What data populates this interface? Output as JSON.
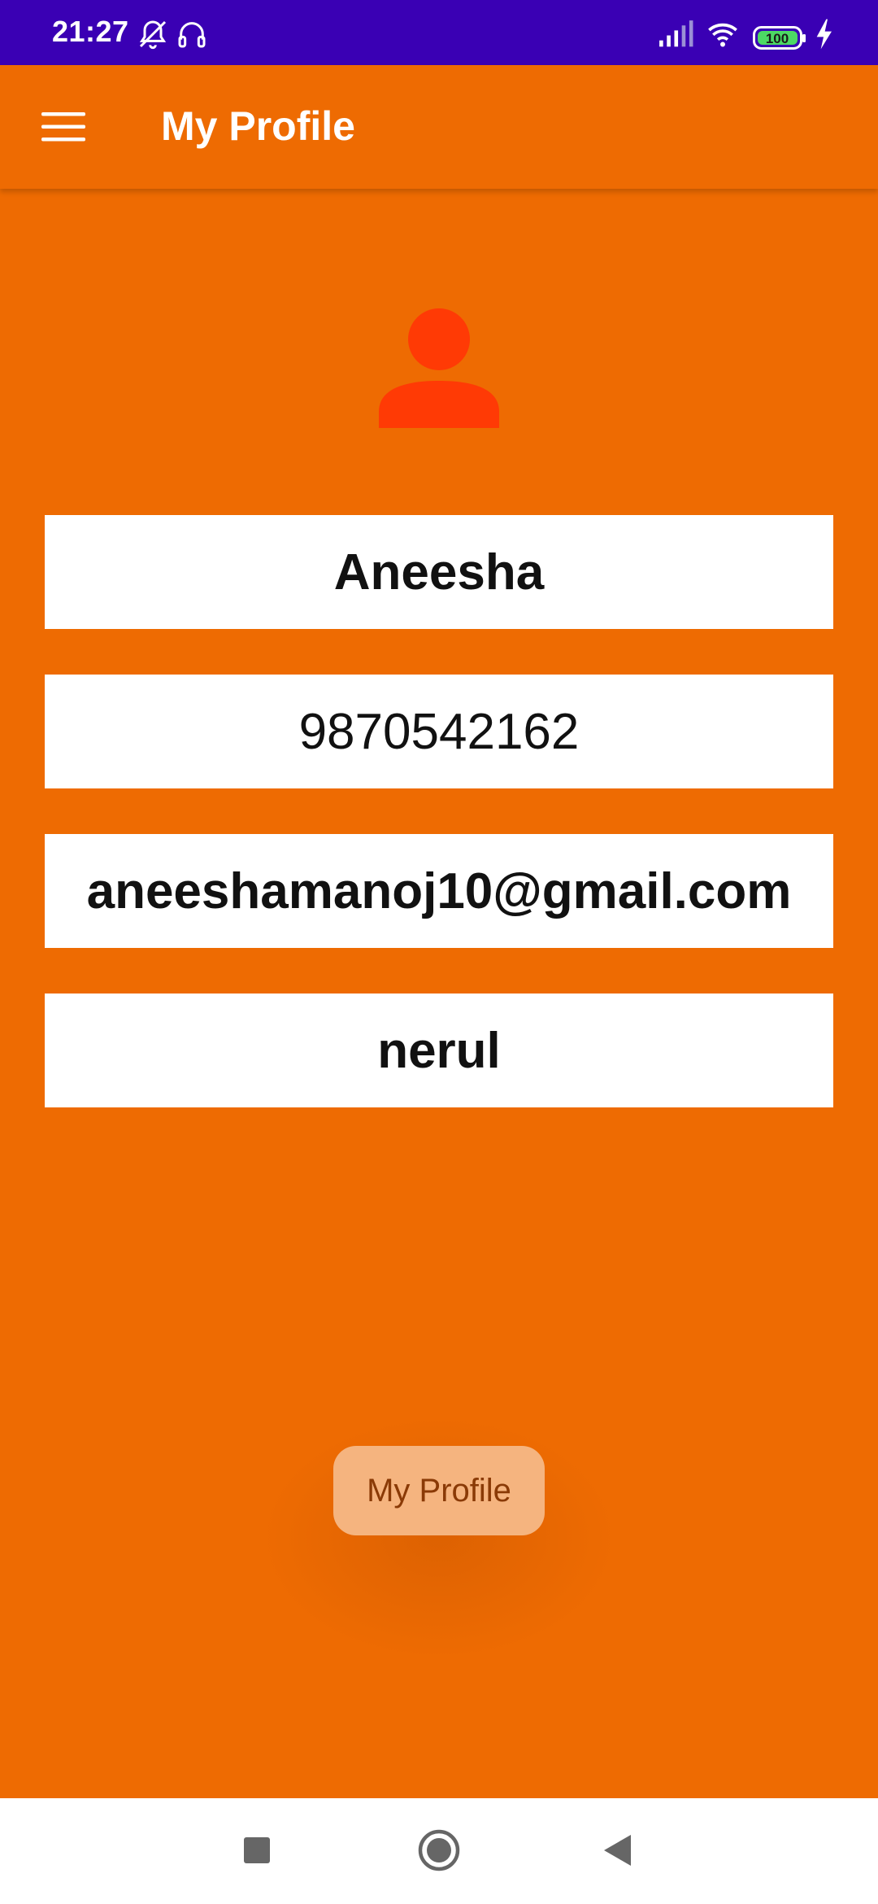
{
  "status_bar": {
    "time": "21:27",
    "battery_level": "100",
    "icons": [
      "mute-icon",
      "headset-icon",
      "signal-icon",
      "wifi-icon",
      "battery-icon",
      "charging-icon"
    ]
  },
  "app_bar": {
    "title": "My Profile",
    "menu_icon": "hamburger-menu-icon"
  },
  "profile": {
    "avatar_icon": "person-icon",
    "name": "Aneesha",
    "phone": "9870542162",
    "email": "aneeshamanoj10@gmail.com",
    "location": "nerul"
  },
  "toast": {
    "text": "My Profile"
  },
  "nav_bar": {
    "icons": [
      "recents-square-icon",
      "home-circle-icon",
      "back-triangle-icon"
    ]
  },
  "colors": {
    "status_bar": "#3a00b4",
    "primary": "#ee6b02",
    "avatar": "#ff3a05",
    "toast_bg": "#f5b47f",
    "toast_text": "#8a3a06"
  }
}
